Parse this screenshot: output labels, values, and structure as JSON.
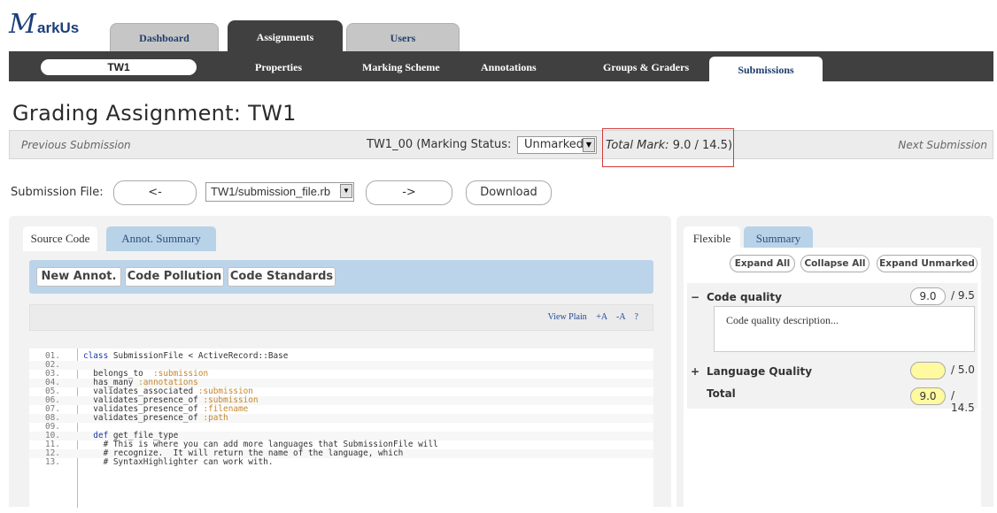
{
  "app": {
    "logo_text": "arkUs",
    "logo_mark": "M"
  },
  "top_tabs": [
    {
      "label": "Dashboard",
      "active": false
    },
    {
      "label": "Assignments",
      "active": true
    },
    {
      "label": "Users",
      "active": false
    }
  ],
  "subnav": {
    "assignment": "TW1",
    "items": [
      {
        "label": "Properties"
      },
      {
        "label": "Marking Scheme"
      },
      {
        "label": "Annotations"
      },
      {
        "label": "Groups & Graders"
      },
      {
        "label": "Submissions",
        "active": true
      }
    ]
  },
  "page_title": "Grading Assignment: TW1",
  "grading_bar": {
    "previous": "Previous Submission",
    "next": "Next Submission",
    "submission_text": "TW1_00 (Marking Status:",
    "marking_status": "Unmarked",
    "total_mark_label": "Total Mark:",
    "total_mark_value": "9.0 / 14.5)"
  },
  "submission_file": {
    "label": "Submission File:",
    "prev_button": "<-",
    "next_button": "->",
    "selected_file": "TW1/submission_file.rb",
    "download_button": "Download"
  },
  "left_panel": {
    "tabs": [
      {
        "label": "Source Code",
        "active": true
      },
      {
        "label": "Annot. Summary",
        "active": false
      }
    ],
    "annotation_buttons": [
      "New Annot.",
      "Code Pollution",
      "Code Standards"
    ],
    "view_links": [
      "View Plain",
      "+A",
      "-A",
      "?"
    ],
    "code_lines": [
      {
        "num": "01.",
        "text": "class SubmissionFile < ActiveRecord::Base"
      },
      {
        "num": "02.",
        "text": ""
      },
      {
        "num": "03.",
        "text": "  belongs_to  :submission"
      },
      {
        "num": "04.",
        "text": "  has_many :annotations"
      },
      {
        "num": "05.",
        "text": "  validates_associated :submission"
      },
      {
        "num": "06.",
        "text": "  validates_presence_of :submission"
      },
      {
        "num": "07.",
        "text": "  validates_presence_of :filename"
      },
      {
        "num": "08.",
        "text": "  validates_presence_of :path"
      },
      {
        "num": "09.",
        "text": ""
      },
      {
        "num": "10.",
        "text": "  def get_file_type"
      },
      {
        "num": "11.",
        "text": "    # This is where you can add more languages that SubmissionFile will"
      },
      {
        "num": "12.",
        "text": "    # recognize.  It will return the name of the language, which"
      },
      {
        "num": "13.",
        "text": "    # SyntaxHighlighter can work with."
      }
    ]
  },
  "right_panel": {
    "tabs": [
      {
        "label": "Flexible",
        "active": true
      },
      {
        "label": "Summary",
        "active": false
      }
    ],
    "buttons": [
      "Expand All",
      "Collapse All",
      "Expand Unmarked"
    ],
    "criteria": [
      {
        "toggle": "−",
        "name": "Code quality",
        "mark": "9.0",
        "out_of": "/ 9.5",
        "description": "Code quality description..."
      },
      {
        "toggle": "+",
        "name": "Language Quality",
        "mark": "",
        "out_of": "/ 5.0"
      }
    ],
    "total": {
      "label": "Total",
      "mark": "9.0",
      "out_of": "/ 14.5"
    },
    "colors": {
      "mark_highlight": "#fffaa0"
    }
  }
}
